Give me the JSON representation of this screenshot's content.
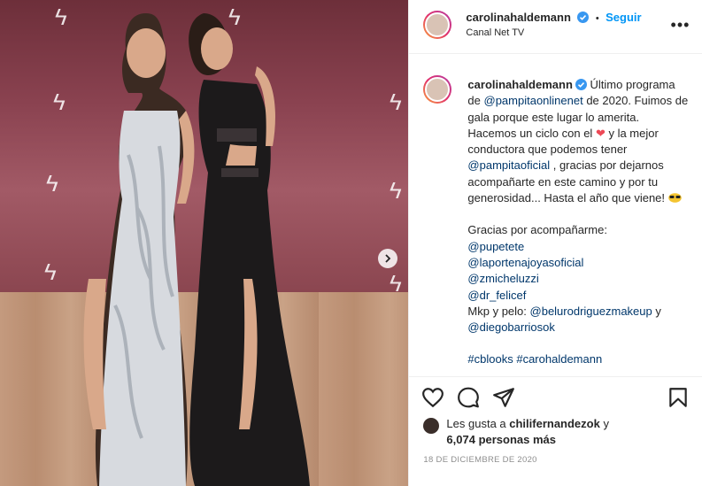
{
  "header": {
    "username": "carolinahaldemann",
    "separator": "•",
    "follow_label": "Seguir",
    "location": "Canal Net TV",
    "more_label": "•••"
  },
  "caption": {
    "username": "carolinahaldemann",
    "part1": "Último programa de ",
    "mention1": "@pampitaonlinenet",
    "part2": " de 2020. Fuimos de gala porque este lugar lo amerita. Hacemos un ciclo con el ",
    "heart": "❤",
    "part3": " y la mejor conductora que podemos tener ",
    "mention2": "@pampitaoficial",
    "part4": " , gracias por dejarnos acompañarte en este camino y por tu generosidad... Hasta el año que viene! ",
    "thanks": "Gracias por acompañarme:",
    "mentions": [
      "@pupetete",
      "@laportenajoyasoficial",
      "@zmicheluzzi",
      "@dr_felicef"
    ],
    "mkp_prefix": "Mkp y pelo: ",
    "mkp_mention1": "@belurodriguezmakeup",
    "mkp_and": " y",
    "mkp_mention2": "@diegobarriosok",
    "hashtags": "#cblooks #carohaldemann"
  },
  "likes": {
    "prefix": "Les gusta a ",
    "user": "chilifernandezok",
    "and": " y",
    "count": "6,074 personas más"
  },
  "date": "18 DE DICIEMBRE DE 2020",
  "colors": {
    "link": "#0095f6",
    "mention": "#00376b",
    "heart": "#ed4956"
  }
}
